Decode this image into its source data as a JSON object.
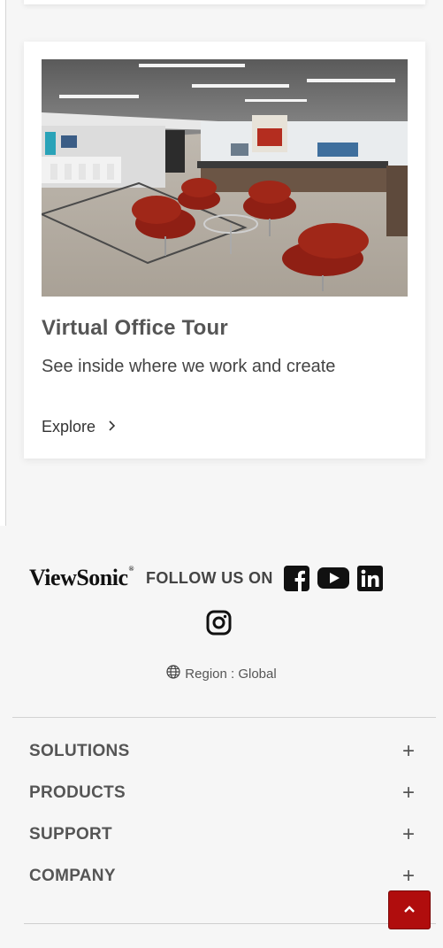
{
  "card": {
    "title": "Virtual Office Tour",
    "description": "See inside where we work and create",
    "link_label": "Explore",
    "link_icon": "chevron-right-icon"
  },
  "footer": {
    "brand": "ViewSonic",
    "brand_mark": "®",
    "follow_label": "FOLLOW US ON",
    "social": [
      "facebook-icon",
      "youtube-icon",
      "linkedin-icon",
      "instagram-icon"
    ],
    "region_icon": "globe-icon",
    "region_label": "Region : Global",
    "menu": [
      {
        "label": "SOLUTIONS",
        "icon": "plus-icon"
      },
      {
        "label": "PRODUCTS",
        "icon": "plus-icon"
      },
      {
        "label": "SUPPORT",
        "icon": "plus-icon"
      },
      {
        "label": "COMPANY",
        "icon": "plus-icon"
      }
    ],
    "plus_symbol": "+",
    "back_to_top_icon": "chevron-up-icon"
  },
  "colors": {
    "background": "#f6f6f6",
    "card": "#ffffff",
    "accent": "#b00d0d",
    "text": "#555555"
  }
}
